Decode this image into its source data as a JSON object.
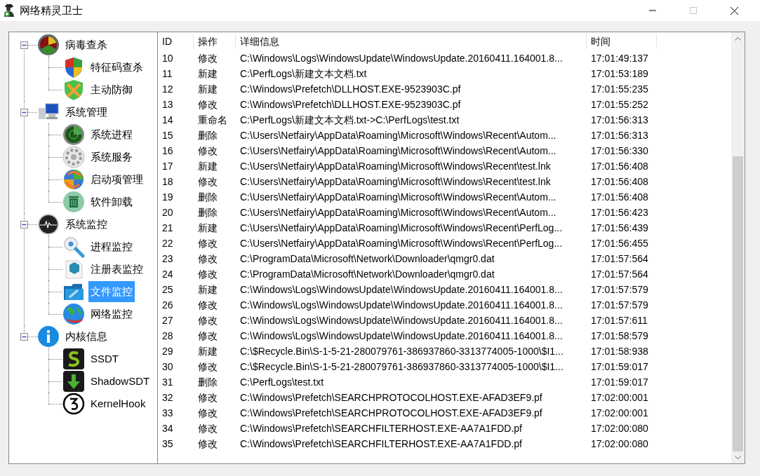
{
  "window": {
    "title": "网络精灵卫士",
    "maximize_disabled": true
  },
  "tree": [
    {
      "label": "病毒查杀",
      "expanded": true,
      "selected": false,
      "children": [
        {
          "label": "特征码查杀",
          "selected": false
        },
        {
          "label": "主动防御",
          "selected": false
        }
      ]
    },
    {
      "label": "系统管理",
      "expanded": true,
      "selected": false,
      "children": [
        {
          "label": "系统进程",
          "selected": false
        },
        {
          "label": "系统服务",
          "selected": false
        },
        {
          "label": "启动项管理",
          "selected": false
        },
        {
          "label": "软件卸载",
          "selected": false
        }
      ]
    },
    {
      "label": "系统监控",
      "expanded": true,
      "selected": false,
      "children": [
        {
          "label": "进程监控",
          "selected": false
        },
        {
          "label": "注册表监控",
          "selected": false
        },
        {
          "label": "文件监控",
          "selected": true
        },
        {
          "label": "网络监控",
          "selected": false
        }
      ]
    },
    {
      "label": "内核信息",
      "expanded": true,
      "selected": false,
      "children": [
        {
          "label": "SSDT",
          "selected": false
        },
        {
          "label": "ShadowSDT",
          "selected": false
        },
        {
          "label": "KernelHook",
          "selected": false
        }
      ]
    }
  ],
  "table": {
    "columns": [
      "ID",
      "操作",
      "详细信息",
      "时间"
    ],
    "rows": [
      [
        "10",
        "修改",
        "C:\\Windows\\Logs\\WindowsUpdate\\WindowsUpdate.20160411.164001.8...",
        "17:01:49:137"
      ],
      [
        "11",
        "新建",
        "C:\\PerfLogs\\新建文本文档.txt",
        "17:01:53:189"
      ],
      [
        "12",
        "新建",
        "C:\\Windows\\Prefetch\\DLLHOST.EXE-9523903C.pf",
        "17:01:55:235"
      ],
      [
        "13",
        "修改",
        "C:\\Windows\\Prefetch\\DLLHOST.EXE-9523903C.pf",
        "17:01:55:252"
      ],
      [
        "14",
        "重命名",
        "C:\\PerfLogs\\新建文本文档.txt->C:\\PerfLogs\\test.txt",
        "17:01:56:313"
      ],
      [
        "15",
        "删除",
        "C:\\Users\\Netfairy\\AppData\\Roaming\\Microsoft\\Windows\\Recent\\Autom...",
        "17:01:56:313"
      ],
      [
        "16",
        "修改",
        "C:\\Users\\Netfairy\\AppData\\Roaming\\Microsoft\\Windows\\Recent\\Autom...",
        "17:01:56:330"
      ],
      [
        "17",
        "新建",
        "C:\\Users\\Netfairy\\AppData\\Roaming\\Microsoft\\Windows\\Recent\\test.lnk",
        "17:01:56:408"
      ],
      [
        "18",
        "修改",
        "C:\\Users\\Netfairy\\AppData\\Roaming\\Microsoft\\Windows\\Recent\\test.lnk",
        "17:01:56:408"
      ],
      [
        "19",
        "删除",
        "C:\\Users\\Netfairy\\AppData\\Roaming\\Microsoft\\Windows\\Recent\\Autom...",
        "17:01:56:408"
      ],
      [
        "20",
        "删除",
        "C:\\Users\\Netfairy\\AppData\\Roaming\\Microsoft\\Windows\\Recent\\Autom...",
        "17:01:56:423"
      ],
      [
        "21",
        "新建",
        "C:\\Users\\Netfairy\\AppData\\Roaming\\Microsoft\\Windows\\Recent\\PerfLog...",
        "17:01:56:439"
      ],
      [
        "22",
        "修改",
        "C:\\Users\\Netfairy\\AppData\\Roaming\\Microsoft\\Windows\\Recent\\PerfLog...",
        "17:01:56:455"
      ],
      [
        "23",
        "修改",
        "C:\\ProgramData\\Microsoft\\Network\\Downloader\\qmgr0.dat",
        "17:01:57:564"
      ],
      [
        "24",
        "修改",
        "C:\\ProgramData\\Microsoft\\Network\\Downloader\\qmgr0.dat",
        "17:01:57:564"
      ],
      [
        "25",
        "新建",
        "C:\\Windows\\Logs\\WindowsUpdate\\WindowsUpdate.20160411.164001.8...",
        "17:01:57:579"
      ],
      [
        "26",
        "修改",
        "C:\\Windows\\Logs\\WindowsUpdate\\WindowsUpdate.20160411.164001.8...",
        "17:01:57:579"
      ],
      [
        "27",
        "修改",
        "C:\\Windows\\Logs\\WindowsUpdate\\WindowsUpdate.20160411.164001.8...",
        "17:01:57:611"
      ],
      [
        "28",
        "修改",
        "C:\\Windows\\Logs\\WindowsUpdate\\WindowsUpdate.20160411.164001.8...",
        "17:01:58:579"
      ],
      [
        "29",
        "新建",
        "C:\\$Recycle.Bin\\S-1-5-21-280079761-386937860-3313774005-1000\\$I1...",
        "17:01:58:938"
      ],
      [
        "30",
        "修改",
        "C:\\$Recycle.Bin\\S-1-5-21-280079761-386937860-3313774005-1000\\$I1...",
        "17:01:59:017"
      ],
      [
        "31",
        "删除",
        "C:\\PerfLogs\\test.txt",
        "17:01:59:017"
      ],
      [
        "32",
        "修改",
        "C:\\Windows\\Prefetch\\SEARCHPROTOCOLHOST.EXE-AFAD3EF9.pf",
        "17:02:00:001"
      ],
      [
        "33",
        "修改",
        "C:\\Windows\\Prefetch\\SEARCHPROTOCOLHOST.EXE-AFAD3EF9.pf",
        "17:02:00:001"
      ],
      [
        "34",
        "修改",
        "C:\\Windows\\Prefetch\\SEARCHFILTERHOST.EXE-AA7A1FDD.pf",
        "17:02:00:080"
      ],
      [
        "35",
        "修改",
        "C:\\Windows\\Prefetch\\SEARCHFILTERHOST.EXE-AA7A1FDD.pf",
        "17:02:00:080"
      ]
    ]
  }
}
